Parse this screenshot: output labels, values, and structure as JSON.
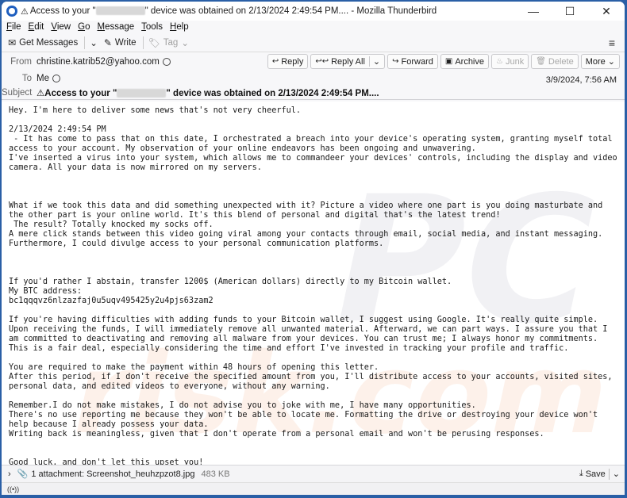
{
  "window": {
    "title_prefix": "Access to your \"",
    "title_suffix": "\" device was obtained on 2/13/2024 2:49:54 PM.... - Mozilla Thunderbird",
    "warning_glyph": "⚠",
    "controls": {
      "minimize": "—",
      "maximize": "☐",
      "close": "✕"
    }
  },
  "menu": [
    "File",
    "Edit",
    "View",
    "Go",
    "Message",
    "Tools",
    "Help"
  ],
  "menu_underline": [
    "F",
    "E",
    "V",
    "G",
    "M",
    "T",
    "H"
  ],
  "toolbar": {
    "get_messages": "Get Messages",
    "write": "Write",
    "tag": "Tag",
    "menu_icon": "≡"
  },
  "header": {
    "from_label": "From",
    "from_value": "christine.katrib52@yahoo.com",
    "to_label": "To",
    "to_value": "Me",
    "subject_label": "Subject",
    "subject_prefix": "⚠Access to your \"",
    "subject_suffix": "\" device was obtained on 2/13/2024 2:49:54 PM....",
    "date": "3/9/2024, 7:56 AM",
    "actions": {
      "reply": "Reply",
      "reply_all": "Reply All",
      "forward": "Forward",
      "archive": "Archive",
      "junk": "Junk",
      "delete": "Delete",
      "more": "More"
    }
  },
  "body": {
    "text": "Hey. I'm here to deliver some news that's not very cheerful.\n\n2/13/2024 2:49:54 PM\n - It has come to pass that on this date, I orchestrated a breach into your device's operating system, granting myself total access to your account. My observation of your online endeavors has been ongoing and unwavering.\nI've inserted a virus into your system, which allows me to commandeer your devices' controls, including the display and video camera. All your data is now mirrored on my servers.\n\n\n\nWhat if we took this data and did something unexpected with it? Picture a video where one part is you doing masturbate and the other part is your online world. It's this blend of personal and digital that's the latest trend!\n The result? Totally knocked my socks off.\nA mere click stands between this video going viral among your contacts through email, social media, and instant messaging. Furthermore, I could divulge access to your personal communication platforms.\n\n\n\nIf you'd rather I abstain, transfer 1200$ (American dollars) directly to my Bitcoin wallet.\nMy BTC address:\nbc1qqqvz6nlzazfaj0u5uqv495425y2u4pjs63zam2\n\nIf you're having difficulties with adding funds to your Bitcoin wallet, I suggest using Google. It's really quite simple.\nUpon receiving the funds, I will immediately remove all unwanted material. Afterward, we can part ways. I assure you that I am committed to deactivating and removing all malware from your devices. You can trust me; I always honor my commitments. This is a fair deal, especially considering the time and effort I've invested in tracking your profile and traffic.\n\nYou are required to make the payment within 48 hours of opening this letter.\nAfter this period, if I don't receive the specified amount from you, I'll distribute access to your accounts, visited sites, personal data, and edited videos to everyone, without any warning.\n\nRemember.I do not make mistakes, I do not advise you to joke with me, I have many opportunities.\nThere's no use reporting me because they won't be able to locate me. Formatting the drive or destroying your device won't help because I already possess your data.\nWriting back is meaningless, given that I don't operate from a personal email and won't be perusing responses.\n\n\nGood luck, and don't let this upset you!\nP.S. As a word of advice for the future, always follow online safety protocols and refrain from visiting sketchy sites."
  },
  "attachment": {
    "label": "1 attachment: Screenshot_heuhzpzot8.jpg",
    "size": "483 KB",
    "save": "Save"
  },
  "status": {
    "icon_glyph": "((•))"
  },
  "colors": {
    "frame": "#2a5fa6",
    "accent": "#1f5fbf"
  }
}
